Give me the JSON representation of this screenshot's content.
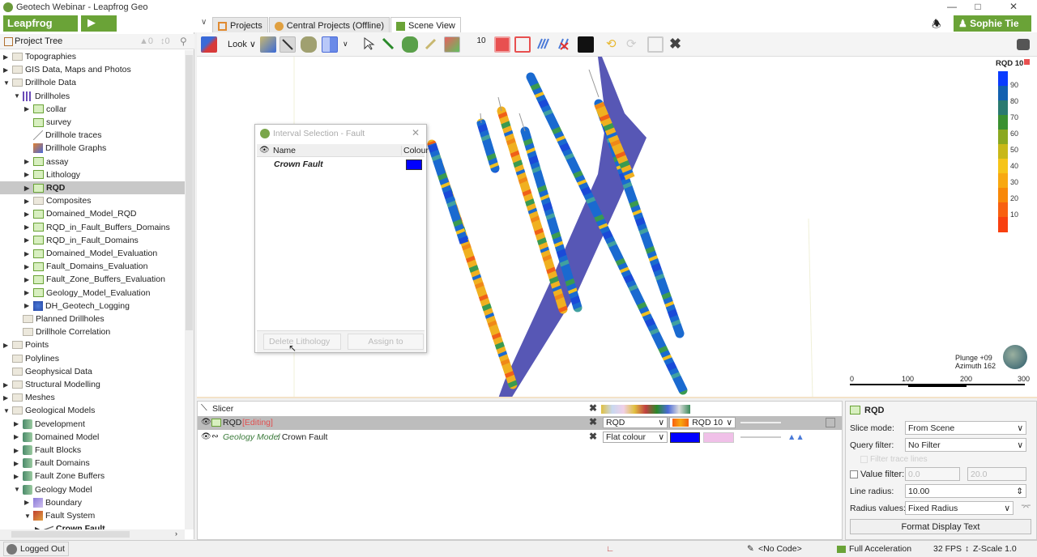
{
  "window": {
    "title": "Geotech Webinar - Leapfrog Geo",
    "minimize": "—",
    "maximize": "□",
    "close": "✕"
  },
  "app": {
    "menu_label": "Leapfrog Geo ∨",
    "play_icon": "▶",
    "user_label": "♟ Sophie Tie ∨",
    "bell_icon": "♪"
  },
  "tabs": [
    {
      "label": "Projects",
      "icon": "projects-icon",
      "active": false
    },
    {
      "label": "Central Projects (Offline)",
      "icon": "central-icon",
      "active": false
    },
    {
      "label": "Scene View",
      "icon": "scene-icon",
      "active": true
    }
  ],
  "tree": {
    "header": "Project Tree",
    "up_count": "0",
    "down_count": "0",
    "items": [
      {
        "label": "Topographies",
        "depth": 0,
        "arrow": "▶",
        "icon": "folder"
      },
      {
        "label": "GIS Data, Maps and Photos",
        "depth": 0,
        "arrow": "▶",
        "icon": "folder"
      },
      {
        "label": "Drillhole Data",
        "depth": 0,
        "arrow": "▼",
        "icon": "folder"
      },
      {
        "label": "Drillholes",
        "depth": 1,
        "arrow": "▼",
        "icon": "drillholes"
      },
      {
        "label": "collar",
        "depth": 2,
        "arrow": "▶",
        "icon": "table"
      },
      {
        "label": "survey",
        "depth": 2,
        "arrow": "",
        "icon": "table"
      },
      {
        "label": "Drillhole traces",
        "depth": 2,
        "arrow": "",
        "icon": "traces"
      },
      {
        "label": "Drillhole Graphs",
        "depth": 2,
        "arrow": "",
        "icon": "graphs"
      },
      {
        "label": "assay",
        "depth": 2,
        "arrow": "▶",
        "icon": "table"
      },
      {
        "label": "Lithology",
        "depth": 2,
        "arrow": "▶",
        "icon": "table"
      },
      {
        "label": "RQD",
        "depth": 2,
        "arrow": "▶",
        "icon": "table",
        "selected": true
      },
      {
        "label": "Composites",
        "depth": 2,
        "arrow": "▶",
        "icon": "folder"
      },
      {
        "label": "Domained_Model_RQD",
        "depth": 2,
        "arrow": "▶",
        "icon": "table"
      },
      {
        "label": "RQD_in_Fault_Buffers_Domains",
        "depth": 2,
        "arrow": "▶",
        "icon": "table"
      },
      {
        "label": "RQD_in_Fault_Domains",
        "depth": 2,
        "arrow": "▶",
        "icon": "table"
      },
      {
        "label": "Domained_Model_Evaluation",
        "depth": 2,
        "arrow": "▶",
        "icon": "table"
      },
      {
        "label": "Fault_Domains_Evaluation",
        "depth": 2,
        "arrow": "▶",
        "icon": "table"
      },
      {
        "label": "Fault_Zone_Buffers_Evaluation",
        "depth": 2,
        "arrow": "▶",
        "icon": "table"
      },
      {
        "label": "Geology_Model_Evaluation",
        "depth": 2,
        "arrow": "▶",
        "icon": "table"
      },
      {
        "label": "DH_Geotech_Logging",
        "depth": 2,
        "arrow": "▶",
        "icon": "db"
      },
      {
        "label": "Planned Drillholes",
        "depth": 1,
        "arrow": "",
        "icon": "folder"
      },
      {
        "label": "Drillhole Correlation",
        "depth": 1,
        "arrow": "",
        "icon": "folder"
      },
      {
        "label": "Points",
        "depth": 0,
        "arrow": "▶",
        "icon": "folder"
      },
      {
        "label": "Polylines",
        "depth": 0,
        "arrow": "",
        "icon": "folder"
      },
      {
        "label": "Geophysical Data",
        "depth": 0,
        "arrow": "",
        "icon": "folder"
      },
      {
        "label": "Structural Modelling",
        "depth": 0,
        "arrow": "▶",
        "icon": "folder"
      },
      {
        "label": "Meshes",
        "depth": 0,
        "arrow": "▶",
        "icon": "folder"
      },
      {
        "label": "Geological Models",
        "depth": 0,
        "arrow": "▼",
        "icon": "folder"
      },
      {
        "label": "Development",
        "depth": 1,
        "arrow": "▶",
        "icon": "geomodel"
      },
      {
        "label": "Domained Model",
        "depth": 1,
        "arrow": "▶",
        "icon": "geomodel"
      },
      {
        "label": "Fault Blocks",
        "depth": 1,
        "arrow": "▶",
        "icon": "geomodel"
      },
      {
        "label": "Fault Domains",
        "depth": 1,
        "arrow": "▶",
        "icon": "geomodel"
      },
      {
        "label": "Fault Zone Buffers",
        "depth": 1,
        "arrow": "▶",
        "icon": "geomodel"
      },
      {
        "label": "Geology Model",
        "depth": 1,
        "arrow": "▼",
        "icon": "geomodel"
      },
      {
        "label": "Boundary",
        "depth": 2,
        "arrow": "▶",
        "icon": "boundary"
      },
      {
        "label": "Fault System",
        "depth": 2,
        "arrow": "▼",
        "icon": "faultsys"
      },
      {
        "label": "Crown Fault",
        "depth": 3,
        "arrow": "▶",
        "icon": "fault",
        "bold": true
      }
    ]
  },
  "toolbar": {
    "look_label": "Look ∨",
    "slice_width": "10"
  },
  "dialog": {
    "title": "Interval Selection - Fault",
    "close": "✕",
    "col_name": "Name",
    "col_colour": "Colour",
    "rows": [
      {
        "name": "Crown Fault",
        "colour": "#0000ff"
      }
    ],
    "delete_label": "Delete Lithology",
    "assign_label": "Assign to"
  },
  "legend": {
    "title": "RQD 10",
    "ticks": [
      "90",
      "80",
      "70",
      "60",
      "50",
      "40",
      "30",
      "20",
      "10"
    ],
    "colors": [
      "#0a3cff",
      "#1260b0",
      "#2a7a70",
      "#3a9030",
      "#8aa820",
      "#c8b818",
      "#f6c418",
      "#f8a810",
      "#f88808",
      "#f86010",
      "#f84010"
    ]
  },
  "orientation": {
    "plunge": "Plunge +09",
    "azimuth": "Azimuth 162"
  },
  "scalebar": {
    "ticks": [
      "0",
      "100",
      "200",
      "300"
    ]
  },
  "slicer": {
    "rows": [
      {
        "label": "Slicer",
        "type": "slicer"
      },
      {
        "label": "RQD",
        "status": "[Editing]",
        "colour_by": "RQD",
        "colormap": "RQD 10",
        "type": "rqd"
      },
      {
        "prefix": "Geology Model",
        "label": ": Crown Fault",
        "colour_by": "Flat colour",
        "color": "#0000ff",
        "type": "fault"
      }
    ]
  },
  "props": {
    "title": "RQD",
    "slice_mode_label": "Slice mode:",
    "slice_mode_value": "From Scene",
    "query_filter_label": "Query filter:",
    "query_filter_value": "No Filter",
    "filter_trace_lines": "Filter trace lines",
    "value_filter_label": "Value filter:",
    "value_filter_min": "0.0",
    "value_filter_max": "20.0",
    "line_radius_label": "Line radius:",
    "line_radius_value": "10.00",
    "radius_values_label": "Radius values:",
    "radius_values_value": "Fixed Radius",
    "format_button": "Format Display Text"
  },
  "status": {
    "login": "Logged Out",
    "code": "<No Code>",
    "accel": "Full Acceleration",
    "fps": "32 FPS",
    "zscale": "Z-Scale 1.0"
  }
}
